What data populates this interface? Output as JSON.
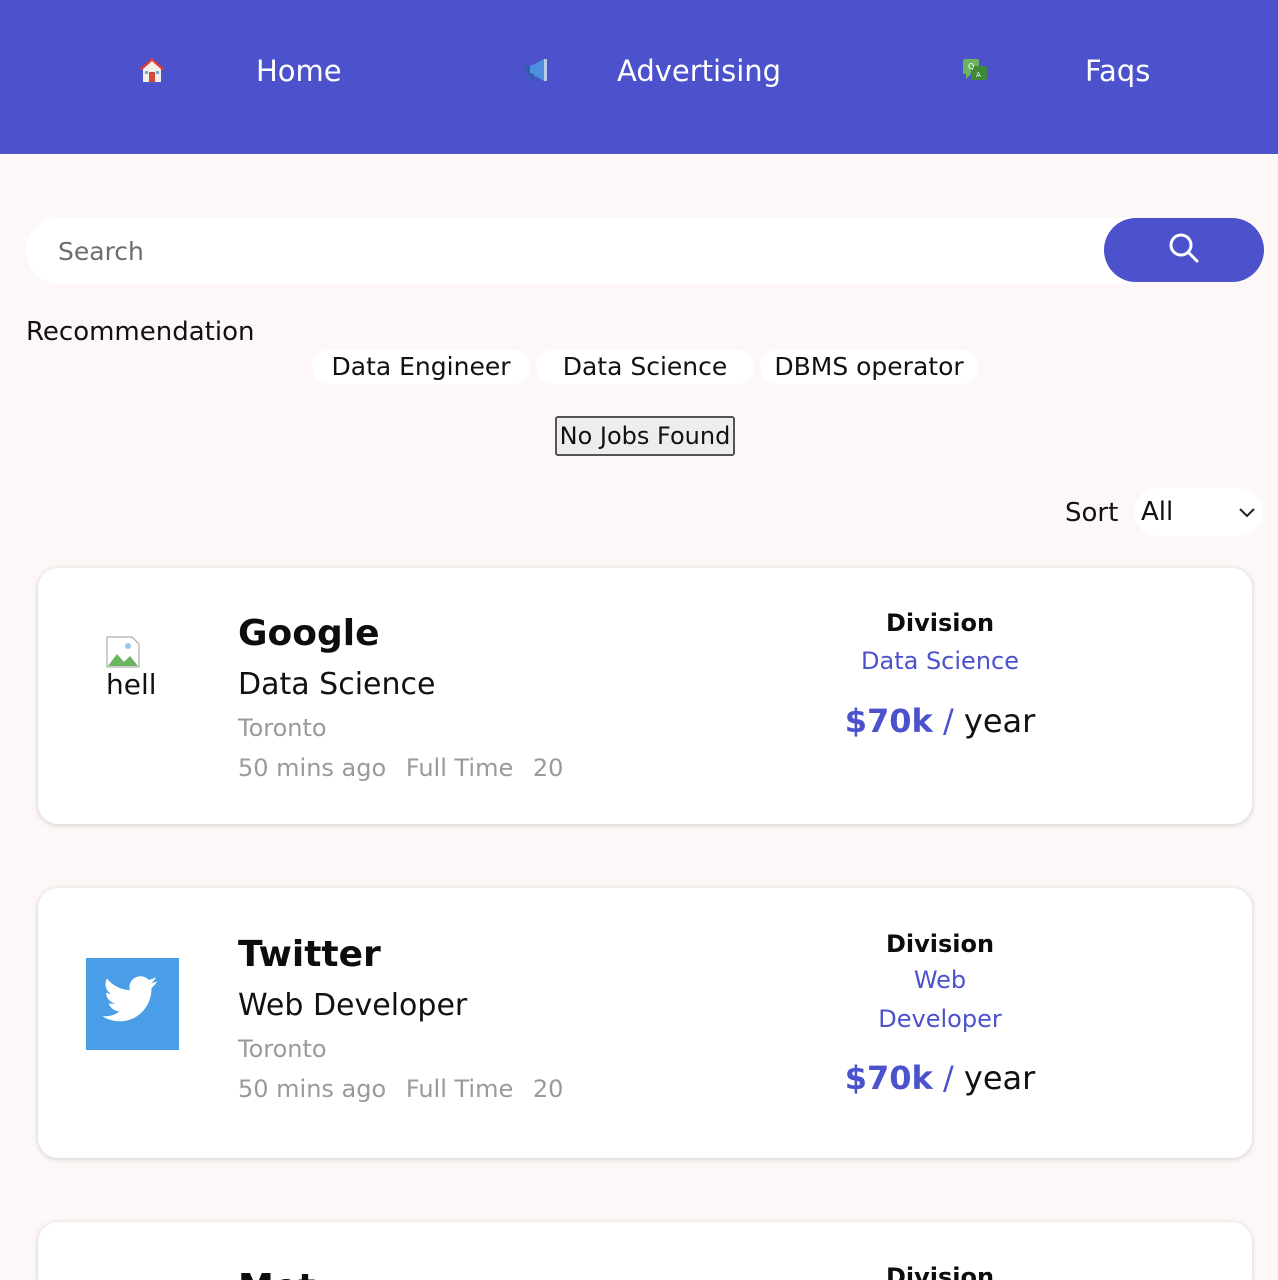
{
  "nav": {
    "items": [
      {
        "label": "Home",
        "icon": "home-icon"
      },
      {
        "label": "Advertising",
        "icon": "megaphone-icon"
      },
      {
        "label": "Faqs",
        "icon": "faq-icon"
      }
    ]
  },
  "search": {
    "placeholder": "Search",
    "button_icon": "search-icon"
  },
  "recommendation": {
    "title": "Recommendation",
    "chips": [
      "Data Engineer",
      "Data Science",
      "DBMS operator"
    ]
  },
  "status": {
    "no_jobs": "No Jobs Found"
  },
  "sort": {
    "label": "Sort",
    "value": "All"
  },
  "jobs": [
    {
      "company": "Google",
      "logo_alt": "hell",
      "title": "Data Science",
      "location": "Toronto",
      "posted": "50 mins ago",
      "type": "Full Time",
      "count": "20",
      "division_label": "Division",
      "division": "Data Science",
      "salary": "$70k",
      "salary_sep": "/",
      "salary_period": "year"
    },
    {
      "company": "Twitter",
      "title": "Web Developer",
      "location": "Toronto",
      "posted": "50 mins ago",
      "type": "Full Time",
      "count": "20",
      "division_label": "Division",
      "division_line1": "Web",
      "division_line2": "Developer",
      "salary": "$70k",
      "salary_sep": "/",
      "salary_period": "year"
    },
    {
      "company": "Met",
      "division_label": "Division"
    }
  ],
  "colors": {
    "primary": "#4c51cc",
    "background": "#fdf8f7",
    "muted_text": "#9a9a9a",
    "twitter_blue": "#4a9ee8"
  }
}
